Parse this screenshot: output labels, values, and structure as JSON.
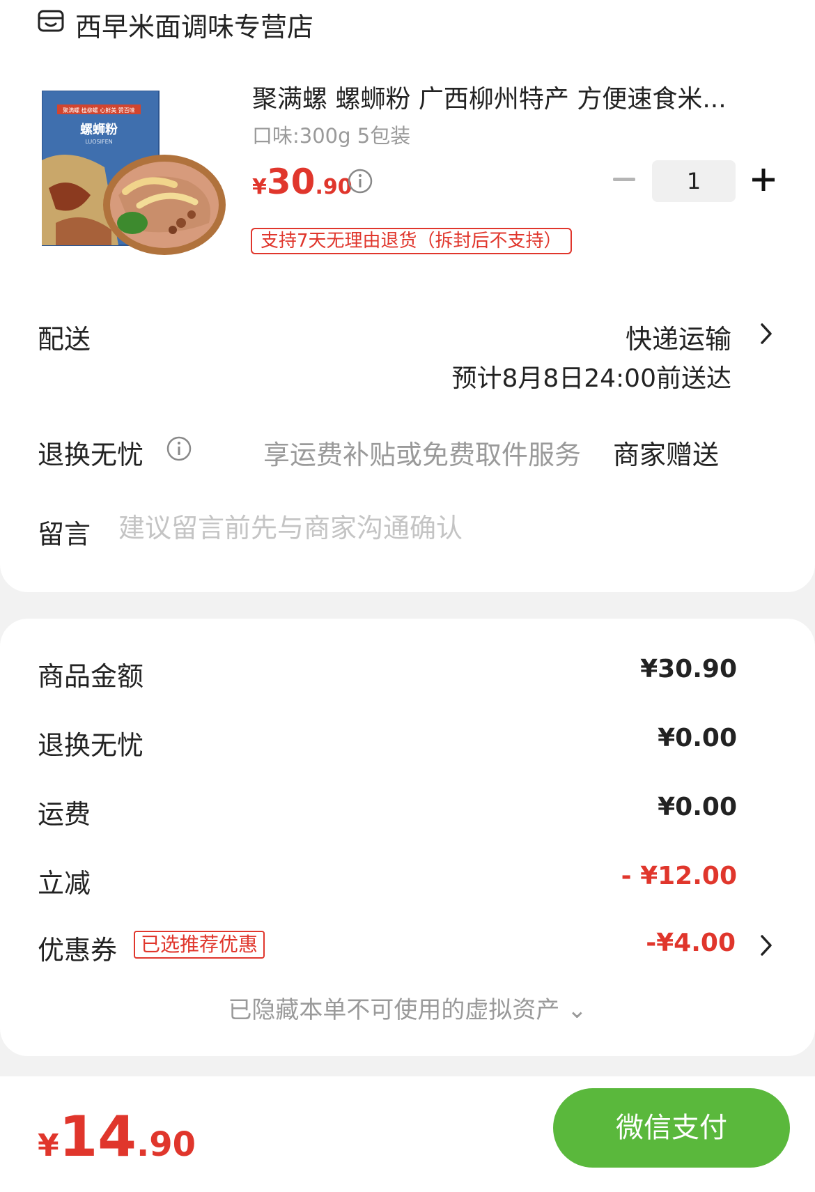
{
  "shop": {
    "name": "西早米面调味专营店",
    "icon": "shop-icon"
  },
  "product": {
    "title": "聚满螺 螺蛳粉 广西柳州特产 方便速食米...",
    "spec": "口味:300g 5包装",
    "price_symbol": "¥",
    "price_int": "30",
    "price_dec": ".90",
    "quantity": "1",
    "return_policy": "支持7天无理由退货（拆封后不支持）",
    "image_box_tag": "聚满螺 桂柳螺 心鲜美 赞百味",
    "image_box_title": "螺蛳粉",
    "image_box_sub": "LUOSIFEN"
  },
  "delivery": {
    "label": "配送",
    "method": "快递运输",
    "eta": "预计8月8日24:00前送达"
  },
  "worry_free": {
    "label": "退换无忧",
    "desc": "享运费补贴或免费取件服务",
    "gift": "商家赠送"
  },
  "message": {
    "label": "留言",
    "placeholder": "建议留言前先与商家沟通确认",
    "value": ""
  },
  "summary": {
    "goods_label": "商品金额",
    "goods_value": "¥30.90",
    "worry_label": "退换无忧",
    "worry_value": "¥0.00",
    "shipping_label": "运费",
    "shipping_value": "¥0.00",
    "discount_label": "立减",
    "discount_value": "- ¥12.00",
    "coupon_label": "优惠券",
    "coupon_tag": "已选推荐优惠",
    "coupon_value": "-¥4.00",
    "hidden_note": "已隐藏本单不可使用的虚拟资产 ⌄"
  },
  "footer": {
    "total_symbol": "¥",
    "total_int": "14",
    "total_dec": ".90",
    "pay_label": "微信支付"
  },
  "colors": {
    "accent_red": "#e0362c",
    "pay_green": "#5ab83c",
    "muted_text": "#9a9a9a"
  }
}
